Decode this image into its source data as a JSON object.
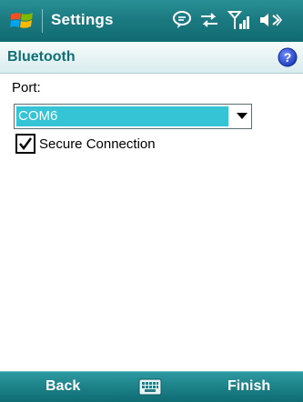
{
  "titlebar": {
    "app_title": "Settings",
    "icons": [
      "windows-start-icon",
      "message-icon",
      "data-connection-icon",
      "signal-strength-icon",
      "volume-icon"
    ]
  },
  "header": {
    "title": "Bluetooth",
    "help_icon": "help-icon"
  },
  "form": {
    "port_label": "Port:",
    "port_value": "COM6",
    "secure_connection_label": "Secure Connection",
    "secure_connection_checked": true
  },
  "softkeys": {
    "left": "Back",
    "center_icon": "keyboard-icon",
    "right": "Finish"
  },
  "colors": {
    "titlebar": "#1c7b82",
    "selection": "#35c3d6",
    "header_text": "#0f6f75"
  }
}
